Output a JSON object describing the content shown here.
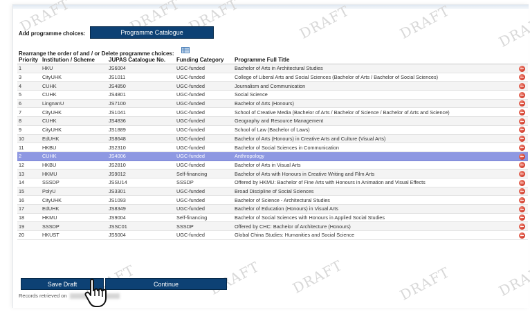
{
  "watermark": "DRAFT",
  "add_label": "Add programme choices:",
  "catalogue_button": "Programme Catalogue",
  "rearrange_label": "Rearrange the order of and / or Delete programme choices:",
  "icons": {
    "table": "table-icon",
    "delete": "minus-circle-icon",
    "cursor": "hand-pointer-icon"
  },
  "colors": {
    "button": "#0d4174",
    "selected_row": "#8e98e2",
    "delete": "#d03a2a"
  },
  "columns": [
    "Priority",
    "Institution / Scheme",
    "JUPAS Catalogue No.",
    "Funding Category",
    "Programme Full Title"
  ],
  "rows": [
    {
      "priority": "1",
      "institution": "HKU",
      "code": "JS6004",
      "funding": "UGC-funded",
      "title": "Bachelor of Arts in Architectural Studies"
    },
    {
      "priority": "3",
      "institution": "CityUHK",
      "code": "JS1011",
      "funding": "UGC-funded",
      "title": "College of Liberal Arts and Social Sciences (Bachelor of Arts / Bachelor of Social Sciences)"
    },
    {
      "priority": "4",
      "institution": "CUHK",
      "code": "JS4850",
      "funding": "UGC-funded",
      "title": "Journalism and Communication"
    },
    {
      "priority": "5",
      "institution": "CUHK",
      "code": "JS4801",
      "funding": "UGC-funded",
      "title": "Social Science"
    },
    {
      "priority": "6",
      "institution": "LingnanU",
      "code": "JS7100",
      "funding": "UGC-funded",
      "title": "Bachelor of Arts (Honours)"
    },
    {
      "priority": "7",
      "institution": "CityUHK",
      "code": "JS1041",
      "funding": "UGC-funded",
      "title": "School of Creative Media (Bachelor of Arts / Bachelor of Science / Bachelor of Arts and Science)"
    },
    {
      "priority": "8",
      "institution": "CUHK",
      "code": "JS4836",
      "funding": "UGC-funded",
      "title": "Geography and Resource Management"
    },
    {
      "priority": "9",
      "institution": "CityUHK",
      "code": "JS1889",
      "funding": "UGC-funded",
      "title": "School of Law (Bachelor of Laws)"
    },
    {
      "priority": "10",
      "institution": "EdUHK",
      "code": "JS8648",
      "funding": "UGC-funded",
      "title": "Bachelor of Arts (Honours) in Creative Arts and Culture (Visual Arts)"
    },
    {
      "priority": "11",
      "institution": "HKBU",
      "code": "JS2310",
      "funding": "UGC-funded",
      "title": "Bachelor of Social Sciences in Communication"
    },
    {
      "priority": "2",
      "institution": "CUHK",
      "code": "JS4006",
      "funding": "UGC-funded",
      "title": "Anthropology",
      "selected": true
    },
    {
      "priority": "12",
      "institution": "HKBU",
      "code": "JS2810",
      "funding": "UGC-funded",
      "title": "Bachelor of Arts in Visual Arts"
    },
    {
      "priority": "13",
      "institution": "HKMU",
      "code": "JS9012",
      "funding": "Self-financing",
      "title": "Bachelor of Arts with Honours in Creative Writing and Film Arts"
    },
    {
      "priority": "14",
      "institution": "SSSDP",
      "code": "JSSU14",
      "funding": "SSSDP",
      "title": "Offered by HKMU: Bachelor of Fine Arts with Honours in Animation and Visual Effects"
    },
    {
      "priority": "15",
      "institution": "PolyU",
      "code": "JS3301",
      "funding": "UGC-funded",
      "title": "Broad Discipline of Social Sciences"
    },
    {
      "priority": "16",
      "institution": "CityUHK",
      "code": "JS1093",
      "funding": "UGC-funded",
      "title": "Bachelor of Science - Architectural Studies"
    },
    {
      "priority": "17",
      "institution": "EdUHK",
      "code": "JS8349",
      "funding": "UGC-funded",
      "title": "Bachelor of Education (Honours) in Visual Arts"
    },
    {
      "priority": "18",
      "institution": "HKMU",
      "code": "JS9004",
      "funding": "Self-financing",
      "title": "Bachelor of Social Sciences with Honours in Applied Social Studies"
    },
    {
      "priority": "19",
      "institution": "SSSDP",
      "code": "JSSC01",
      "funding": "SSSDP",
      "title": "Offered by CHC: Bachelor of Architecture (Honours)"
    },
    {
      "priority": "20",
      "institution": "HKUST",
      "code": "JS5004",
      "funding": "UGC-funded",
      "title": "Global China Studies: Humanities and Social Science"
    }
  ],
  "buttons": {
    "save_draft": "Save Draft",
    "continue": "Continue"
  },
  "records_label": "Records retrieved on"
}
